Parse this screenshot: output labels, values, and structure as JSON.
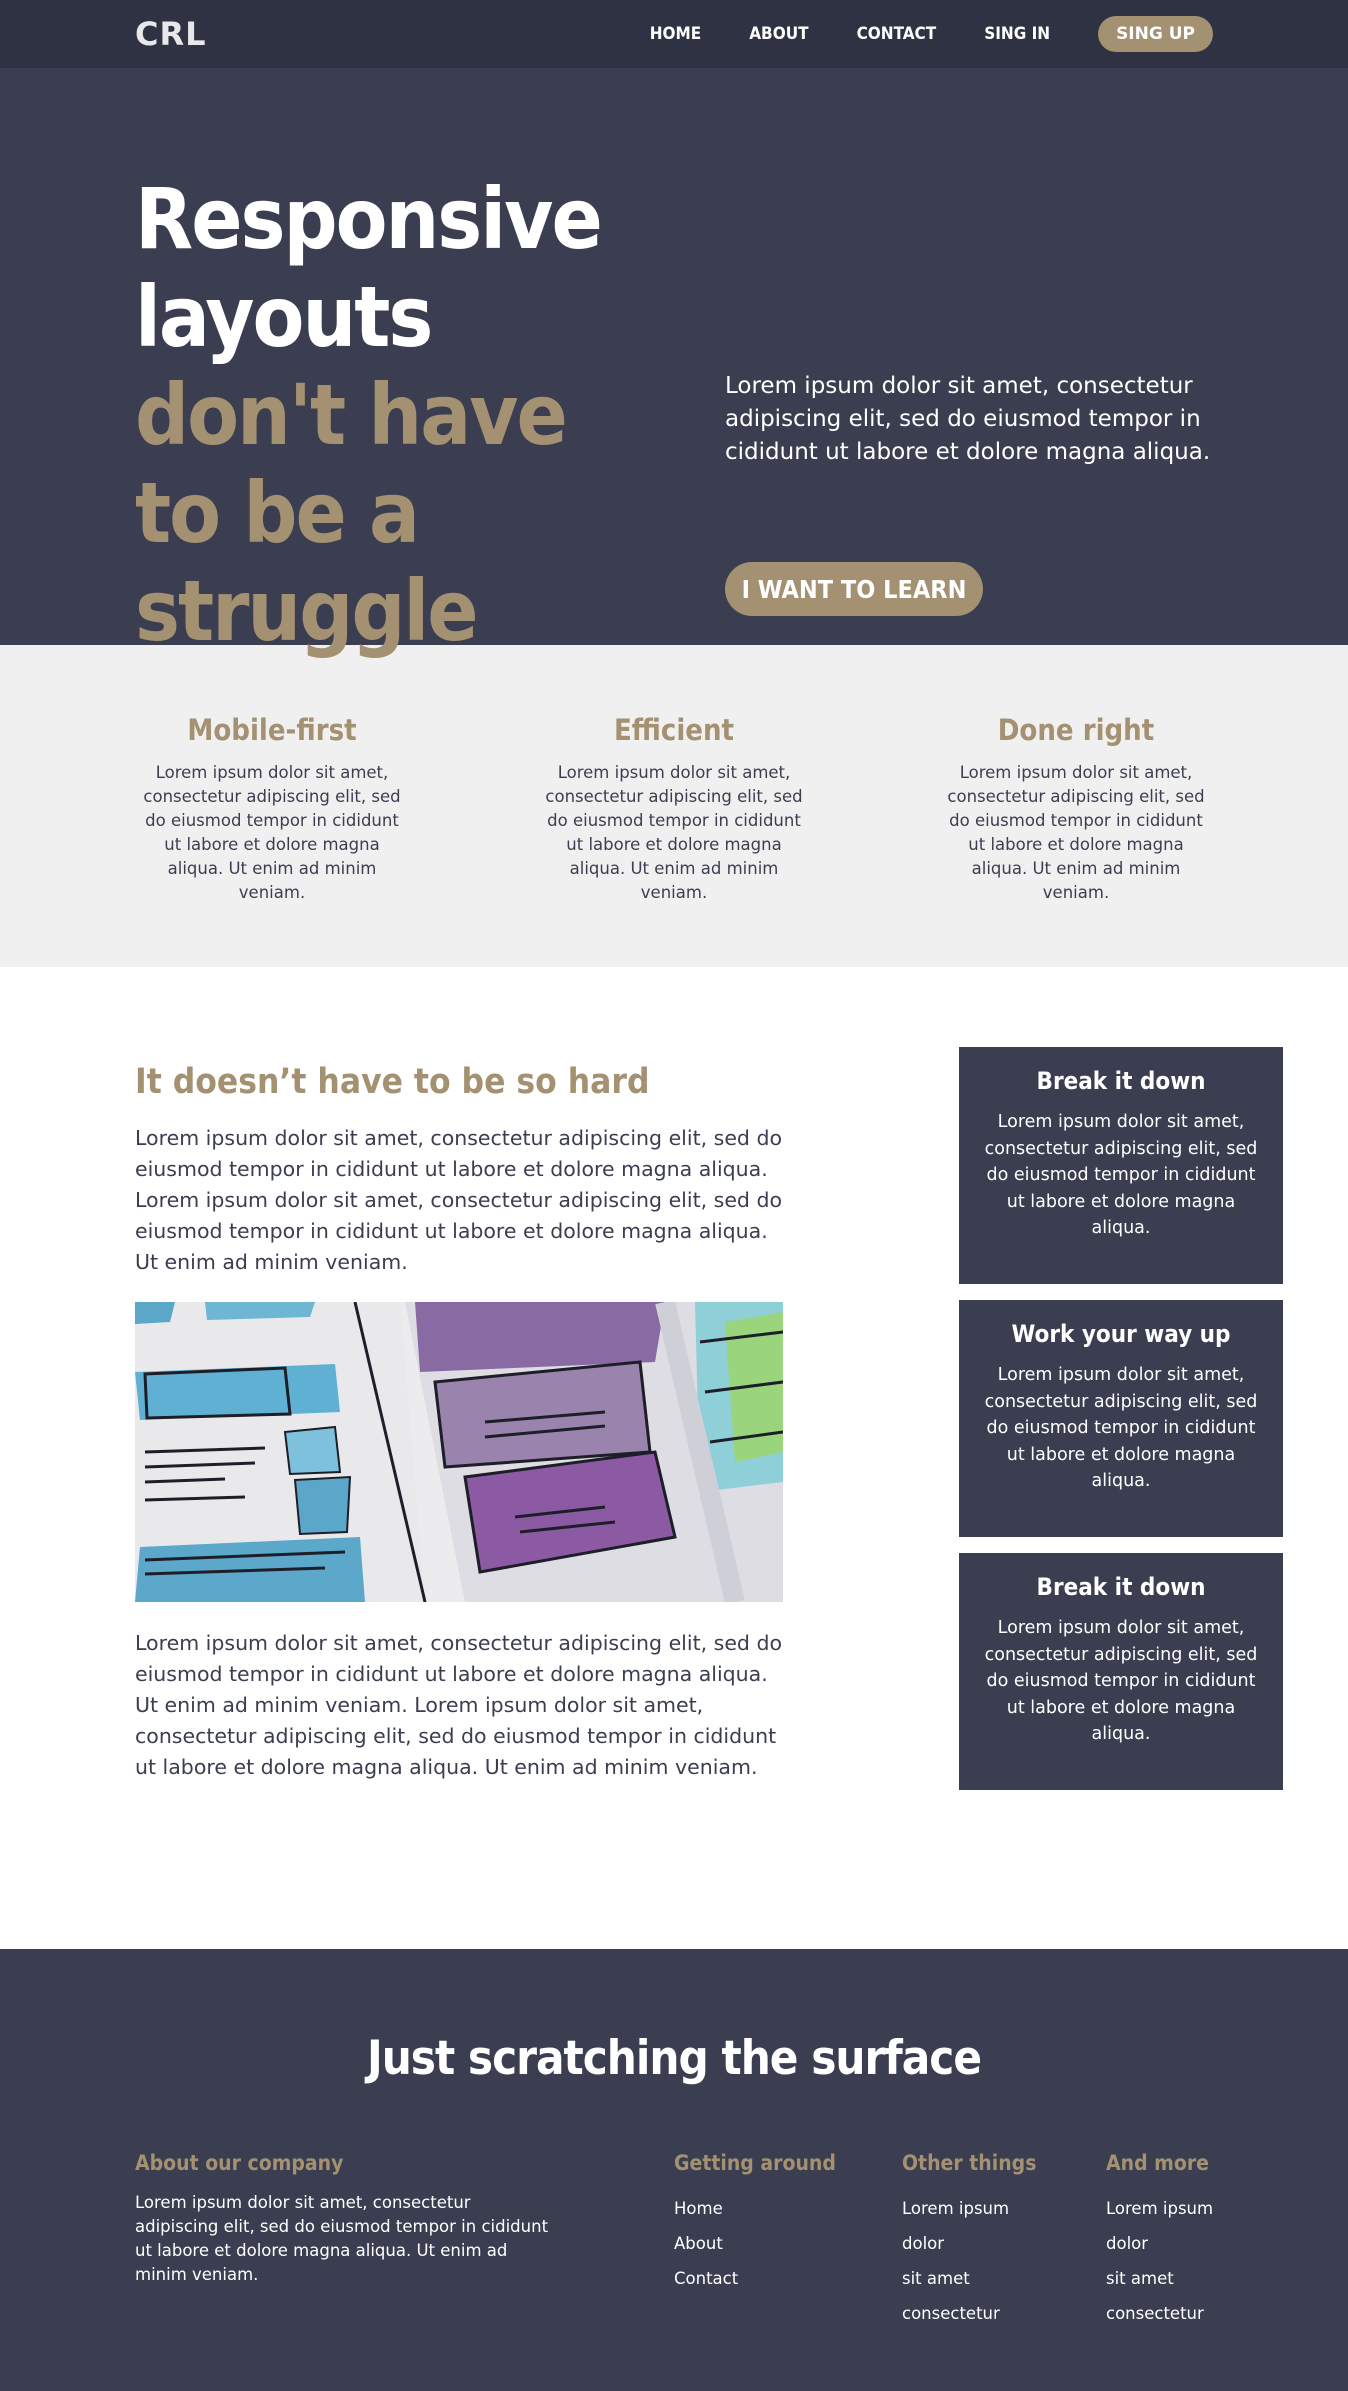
{
  "nav": {
    "logo": "CRL",
    "links": [
      "HOME",
      "ABOUT",
      "CONTACT",
      "SING IN"
    ],
    "cta": "SING UP"
  },
  "hero": {
    "title_part1": "Responsive layouts ",
    "title_accent": "don't have to be a struggle",
    "text": "Lorem ipsum dolor sit amet, consectetur adipiscing elit, sed do eiusmod tempor in cididunt ut labore et dolore magna aliqua.",
    "button": "I WANT TO LEARN"
  },
  "features": [
    {
      "title": "Mobile-first",
      "text": "Lorem ipsum dolor sit amet, consectetur adipiscing elit, sed do eiusmod tempor in cididunt ut labore et dolore magna aliqua. Ut enim ad minim veniam."
    },
    {
      "title": "Efficient",
      "text": "Lorem ipsum dolor sit amet, consectetur adipiscing elit, sed do eiusmod tempor in cididunt ut labore et dolore magna aliqua. Ut enim ad minim veniam."
    },
    {
      "title": "Done right",
      "text": "Lorem ipsum dolor sit amet, consectetur adipiscing elit, sed do eiusmod tempor in cididunt ut labore et dolore magna aliqua. Ut enim ad minim veniam."
    }
  ],
  "article": {
    "title": "It doesn’t have to be so hard",
    "para1": "Lorem ipsum dolor sit amet, consectetur adipiscing elit, sed do eiusmod tempor in cididunt ut labore et dolore magna aliqua. Lorem ipsum dolor sit amet, consectetur adipiscing elit, sed do eiusmod tempor in cididunt ut labore et dolore magna aliqua. Ut enim ad minim veniam.",
    "para2": "Lorem ipsum dolor sit amet, consectetur adipiscing elit, sed do eiusmod tempor in cididunt ut labore et dolore magna aliqua. Ut enim ad minim veniam. Lorem ipsum dolor sit amet, consectetur adipiscing elit, sed do eiusmod tempor in cididunt ut labore et dolore magna aliqua. Ut enim ad minim veniam."
  },
  "sidebar": [
    {
      "title": "Break it down",
      "text": "Lorem ipsum dolor sit amet, consectetur adipiscing elit, sed do eiusmod tempor in cididunt ut labore et dolore magna aliqua."
    },
    {
      "title": "Work your way up",
      "text": "Lorem ipsum dolor sit amet, consectetur adipiscing elit, sed do eiusmod tempor in cididunt ut labore et dolore magna aliqua."
    },
    {
      "title": "Break it down",
      "text": "Lorem ipsum dolor sit amet, consectetur adipiscing elit, sed do eiusmod tempor in cididunt ut labore et dolore magna aliqua."
    }
  ],
  "footer": {
    "title": "Just scratching the surface",
    "about": {
      "title": "About our company",
      "text": "Lorem ipsum dolor sit amet, consectetur adipiscing elit, sed do eiusmod tempor in cididunt ut labore et dolore magna aliqua. Ut enim ad minim veniam."
    },
    "col1": {
      "title": "Getting around",
      "links": [
        "Home",
        "About",
        "Contact"
      ]
    },
    "col2": {
      "title": "Other things",
      "links": [
        "Lorem ipsum",
        "dolor",
        "sit amet",
        "consectetur"
      ]
    },
    "col3": {
      "title": "And more",
      "links": [
        "Lorem ipsum",
        "dolor",
        "sit amet",
        "consectetur"
      ]
    }
  },
  "colors": {
    "nav_bg": "#2f3242",
    "dark_bg": "#3b3e51",
    "accent": "#a39171",
    "light_bg": "#f0f0f0"
  }
}
